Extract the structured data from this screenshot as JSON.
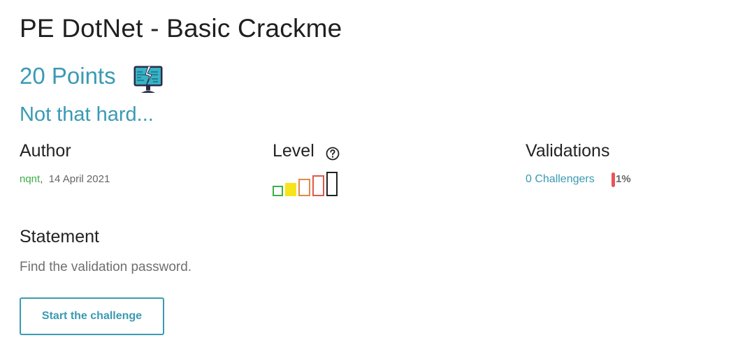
{
  "challenge": {
    "title": "PE DotNet - Basic Crackme",
    "points": "20 Points",
    "subtitle": "Not that hard..."
  },
  "icons": {
    "category": "broken-monitor-icon",
    "help": "question-circle-icon"
  },
  "author": {
    "heading": "Author",
    "name": "nqnt",
    "separator": ",",
    "date": "14 April 2021"
  },
  "level": {
    "heading": "Level",
    "value": 2,
    "max": 5,
    "colors": [
      "#3cb049",
      "#f6e51a",
      "#e08a4a",
      "#e0574d",
      "#222222"
    ]
  },
  "validations": {
    "heading": "Validations",
    "challengers": "0 Challengers",
    "percent": "1%"
  },
  "statement": {
    "heading": "Statement",
    "text": "Find the validation password."
  },
  "actions": {
    "start_label": "Start the challenge"
  },
  "colors": {
    "accent": "#3a9ab3",
    "author_link": "#3cb049",
    "percent_bar": "#e8555a"
  }
}
